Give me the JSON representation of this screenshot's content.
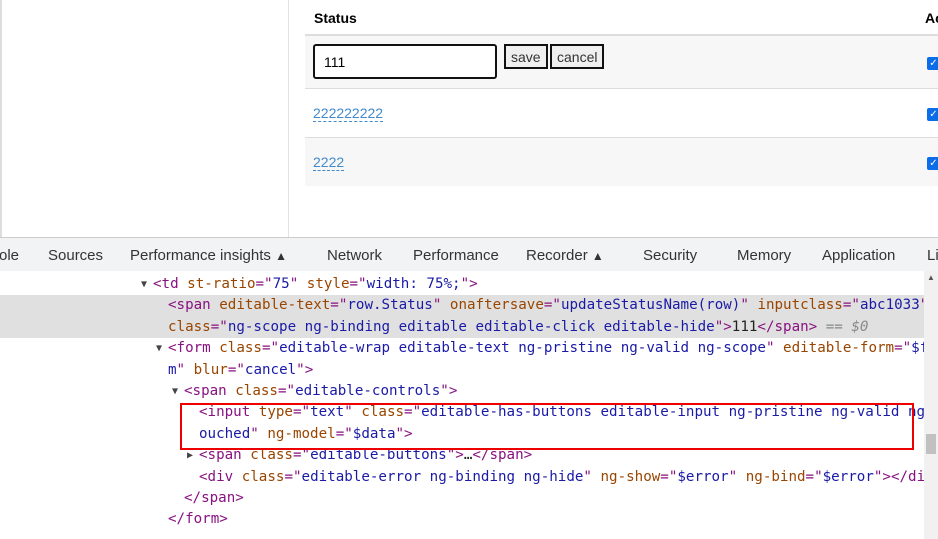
{
  "table": {
    "headers": [
      "Status",
      "Ac"
    ],
    "editing": {
      "value": "111",
      "save_label": "save",
      "cancel_label": "cancel"
    },
    "rows": [
      {
        "status": "222222222",
        "active": true
      },
      {
        "status": "2222",
        "active": true
      }
    ],
    "first_active": true
  },
  "devtools": {
    "tabs": [
      "ole",
      "Sources",
      "Performance insights",
      "Network",
      "Performance",
      "Recorder",
      "Security",
      "Memory",
      "Application",
      "Li"
    ],
    "experimental_icon": "flask-icon",
    "lines": [
      [
        [
          "tag",
          "<td "
        ],
        [
          "attr",
          "st-ratio"
        ],
        [
          "tag",
          "=\""
        ],
        [
          "val",
          "75"
        ],
        [
          "tag",
          "\" "
        ],
        [
          "attr",
          "style"
        ],
        [
          "tag",
          "=\""
        ],
        [
          "val",
          "width: 75%;"
        ],
        [
          "tag",
          "\">"
        ]
      ],
      [
        [
          "tag",
          "<span "
        ],
        [
          "attr",
          "editable-text"
        ],
        [
          "tag",
          "=\""
        ],
        [
          "val",
          "row.Status"
        ],
        [
          "tag",
          "\" "
        ],
        [
          "attr",
          "onaftersave"
        ],
        [
          "tag",
          "=\""
        ],
        [
          "val",
          "updateStatusName(row)"
        ],
        [
          "tag",
          "\" "
        ],
        [
          "attr",
          "inputclass"
        ],
        [
          "tag",
          "=\""
        ],
        [
          "val",
          "abc1033"
        ],
        [
          "tag",
          "\""
        ]
      ],
      [
        [
          "attr",
          "class"
        ],
        [
          "tag",
          "=\""
        ],
        [
          "val",
          "ng-scope ng-binding editable editable-click editable-hide"
        ],
        [
          "tag",
          "\">"
        ],
        [
          "txt",
          "111"
        ],
        [
          "tag",
          "</span>"
        ],
        [
          "cmt",
          " == $0"
        ]
      ],
      [
        [
          "tag",
          "<form "
        ],
        [
          "attr",
          "class"
        ],
        [
          "tag",
          "=\""
        ],
        [
          "val",
          "editable-wrap editable-text ng-pristine ng-valid ng-scope"
        ],
        [
          "tag",
          "\" "
        ],
        [
          "attr",
          "editable-form"
        ],
        [
          "tag",
          "=\""
        ],
        [
          "val",
          "$for"
        ]
      ],
      [
        [
          "val",
          "m"
        ],
        [
          "tag",
          "\" "
        ],
        [
          "attr",
          "blur"
        ],
        [
          "tag",
          "=\""
        ],
        [
          "val",
          "cancel"
        ],
        [
          "tag",
          "\">"
        ]
      ],
      [
        [
          "tag",
          "<span "
        ],
        [
          "attr",
          "class"
        ],
        [
          "tag",
          "=\""
        ],
        [
          "val",
          "editable-controls"
        ],
        [
          "tag",
          "\">"
        ]
      ],
      [
        [
          "tag",
          "<input "
        ],
        [
          "attr",
          "type"
        ],
        [
          "tag",
          "=\""
        ],
        [
          "val",
          "text"
        ],
        [
          "tag",
          "\" "
        ],
        [
          "attr",
          "class"
        ],
        [
          "tag",
          "=\""
        ],
        [
          "val",
          "editable-has-buttons editable-input ng-pristine ng-valid ng-t"
        ]
      ],
      [
        [
          "val",
          "ouched"
        ],
        [
          "tag",
          "\" "
        ],
        [
          "attr",
          "ng-model"
        ],
        [
          "tag",
          "=\""
        ],
        [
          "val",
          "$data"
        ],
        [
          "tag",
          "\">"
        ]
      ],
      [
        [
          "tag",
          "<span "
        ],
        [
          "attr",
          "class"
        ],
        [
          "tag",
          "=\""
        ],
        [
          "val",
          "editable-buttons"
        ],
        [
          "tag",
          "\">"
        ],
        [
          "txt",
          "…"
        ],
        [
          "tag",
          "</span>"
        ]
      ],
      [
        [
          "tag",
          "<div "
        ],
        [
          "attr",
          "class"
        ],
        [
          "tag",
          "=\""
        ],
        [
          "val",
          "editable-error ng-binding ng-hide"
        ],
        [
          "tag",
          "\" "
        ],
        [
          "attr",
          "ng-show"
        ],
        [
          "tag",
          "=\""
        ],
        [
          "val",
          "$error"
        ],
        [
          "tag",
          "\" "
        ],
        [
          "attr",
          "ng-bind"
        ],
        [
          "tag",
          "=\""
        ],
        [
          "val",
          "$error"
        ],
        [
          "tag",
          "\"></div>"
        ]
      ],
      [
        [
          "tag",
          "</span>"
        ]
      ],
      [
        [
          "tag",
          "</form>"
        ]
      ]
    ]
  }
}
